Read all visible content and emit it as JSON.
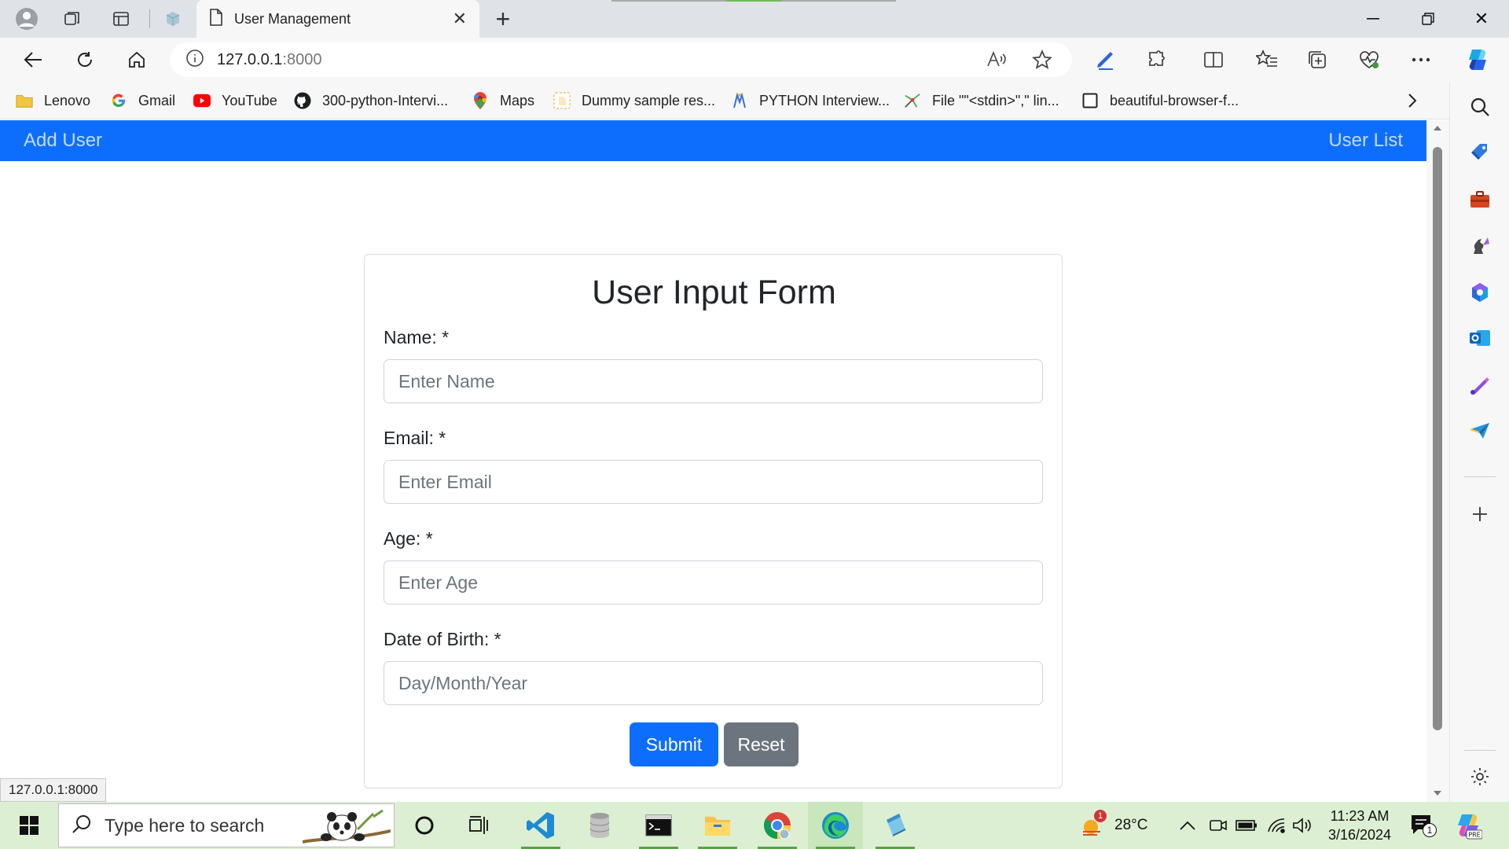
{
  "browser": {
    "tab_title": "User Management",
    "url_host": "127.0.0.1",
    "url_port": ":8000",
    "status_text": "127.0.0.1:8000"
  },
  "bookmarks": [
    {
      "label": "Lenovo",
      "icon": "folder-icon"
    },
    {
      "label": "Gmail",
      "icon": "google-icon"
    },
    {
      "label": "YouTube",
      "icon": "youtube-icon"
    },
    {
      "label": "300-python-Intervi...",
      "icon": "github-icon"
    },
    {
      "label": "Maps",
      "icon": "maps-icon"
    },
    {
      "label": "Dummy sample res...",
      "icon": "document-icon"
    },
    {
      "label": "PYTHON Interview...",
      "icon": "python-icon"
    },
    {
      "label": "File \"\"<stdin>\",\" lin...",
      "icon": "spark-icon"
    },
    {
      "label": "beautiful-browser-f...",
      "icon": "page-icon"
    }
  ],
  "app": {
    "nav_left": "Add User",
    "nav_right": "User List",
    "form_title": "User Input Form",
    "fields": [
      {
        "label": "Name: *",
        "placeholder": "Enter Name"
      },
      {
        "label": "Email: *",
        "placeholder": "Enter Email"
      },
      {
        "label": "Age: *",
        "placeholder": "Enter Age"
      },
      {
        "label": "Date of Birth: *",
        "placeholder": "Day/Month/Year"
      }
    ],
    "submit_label": "Submit",
    "reset_label": "Reset"
  },
  "taskbar": {
    "search_placeholder": "Type here to search",
    "weather": "28°C",
    "weather_badge": "1",
    "time": "11:23 AM",
    "date": "3/16/2024",
    "notification_count": "1"
  },
  "colors": {
    "primary": "#0d6efd",
    "secondary": "#6c757d",
    "taskbar": "#dcefd2"
  }
}
